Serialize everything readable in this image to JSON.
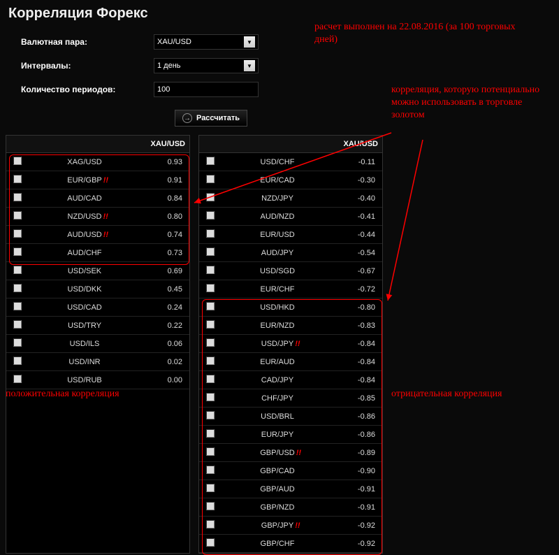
{
  "title": "Корреляция Форекс",
  "form": {
    "pair_label": "Валютная пара:",
    "pair_value": "XAU/USD",
    "interval_label": "Интервалы:",
    "interval_value": "1 день",
    "periods_label": "Количество периодов:",
    "periods_value": "100",
    "calc_label": "Рассчитать"
  },
  "header_col": "XAU/USD",
  "left_rows": [
    {
      "pair": "XAG/USD",
      "val": "0.93",
      "hl": false
    },
    {
      "pair": "EUR/GBP",
      "val": "0.91",
      "hl": true
    },
    {
      "pair": "AUD/CAD",
      "val": "0.84",
      "hl": false
    },
    {
      "pair": "NZD/USD",
      "val": "0.80",
      "hl": true
    },
    {
      "pair": "AUD/USD",
      "val": "0.74",
      "hl": true
    },
    {
      "pair": "AUD/CHF",
      "val": "0.73",
      "hl": false
    },
    {
      "pair": "USD/SEK",
      "val": "0.69",
      "hl": false
    },
    {
      "pair": "USD/DKK",
      "val": "0.45",
      "hl": false
    },
    {
      "pair": "USD/CAD",
      "val": "0.24",
      "hl": false
    },
    {
      "pair": "USD/TRY",
      "val": "0.22",
      "hl": false
    },
    {
      "pair": "USD/ILS",
      "val": "0.06",
      "hl": false
    },
    {
      "pair": "USD/INR",
      "val": "0.02",
      "hl": false
    },
    {
      "pair": "USD/RUB",
      "val": "0.00",
      "hl": false
    }
  ],
  "right_rows": [
    {
      "pair": "USD/CHF",
      "val": "-0.11",
      "hl": false
    },
    {
      "pair": "EUR/CAD",
      "val": "-0.30",
      "hl": false
    },
    {
      "pair": "NZD/JPY",
      "val": "-0.40",
      "hl": false
    },
    {
      "pair": "AUD/NZD",
      "val": "-0.41",
      "hl": false
    },
    {
      "pair": "EUR/USD",
      "val": "-0.44",
      "hl": false
    },
    {
      "pair": "AUD/JPY",
      "val": "-0.54",
      "hl": false
    },
    {
      "pair": "USD/SGD",
      "val": "-0.67",
      "hl": false
    },
    {
      "pair": "EUR/CHF",
      "val": "-0.72",
      "hl": false
    },
    {
      "pair": "USD/HKD",
      "val": "-0.80",
      "hl": false
    },
    {
      "pair": "EUR/NZD",
      "val": "-0.83",
      "hl": false
    },
    {
      "pair": "USD/JPY",
      "val": "-0.84",
      "hl": true
    },
    {
      "pair": "EUR/AUD",
      "val": "-0.84",
      "hl": false
    },
    {
      "pair": "CAD/JPY",
      "val": "-0.84",
      "hl": false
    },
    {
      "pair": "CHF/JPY",
      "val": "-0.85",
      "hl": false
    },
    {
      "pair": "USD/BRL",
      "val": "-0.86",
      "hl": false
    },
    {
      "pair": "EUR/JPY",
      "val": "-0.86",
      "hl": false
    },
    {
      "pair": "GBP/USD",
      "val": "-0.89",
      "hl": true
    },
    {
      "pair": "GBP/CAD",
      "val": "-0.90",
      "hl": false
    },
    {
      "pair": "GBP/AUD",
      "val": "-0.91",
      "hl": false
    },
    {
      "pair": "GBP/NZD",
      "val": "-0.91",
      "hl": false
    },
    {
      "pair": "GBP/JPY",
      "val": "-0.92",
      "hl": true
    },
    {
      "pair": "GBP/CHF",
      "val": "-0.92",
      "hl": false
    }
  ],
  "annotations": {
    "top": "расчет выполнен\nна 22.08.2016\n(за 100 торговых дней)",
    "use": "корреляция, которую\nпотенциально можно\nиспользовать в торговле\nзолотом",
    "positive": "положительная\nкорреляция",
    "negative": "отрицательная корреляция"
  }
}
